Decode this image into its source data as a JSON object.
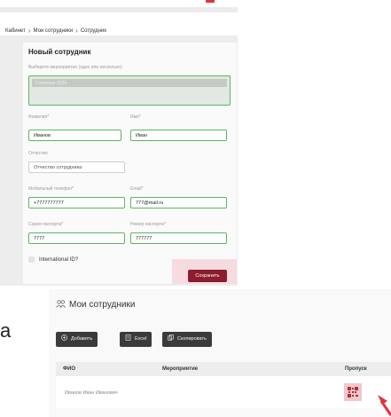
{
  "breadcrumb": {
    "items": [
      "Кабинет",
      "Мои сотрудники",
      "Сотрудник"
    ]
  },
  "form": {
    "title": "Новый сотрудник",
    "events_label": "Выберите мероприятие (одно или несколько)",
    "selected_event": "Comtesse 2024",
    "fields": {
      "lastname_label": "Фамилия*",
      "lastname_value": "Иванов",
      "firstname_label": "Имя*",
      "firstname_value": "Иван",
      "patronymic_label": "Отчество",
      "patronymic_placeholder": "Отчество сотрудника",
      "phone_label": "Мобильный телефон*",
      "phone_value": "+7777777777",
      "email_label": "Email*",
      "email_value": "777@mail.ru",
      "passport_series_label": "Серия паспорта*",
      "passport_series_value": "7777",
      "passport_number_label": "Номер паспорта*",
      "passport_number_value": "777777"
    },
    "international_label": "International ID?",
    "save_label": "Сохранить"
  },
  "side_letter": "а",
  "employees": {
    "title": "Мои сотрудники",
    "toolbar": {
      "add_label": "Добавить",
      "excel_label": "Excel",
      "copy_label": "Скопировать"
    },
    "columns": [
      "ФИО",
      "Мероприятие",
      "Пропуск"
    ],
    "rows": [
      {
        "name": "Иванов Иван Иванович",
        "event": ""
      }
    ]
  },
  "colors": {
    "accent_green": "#5ab760",
    "save_button": "#8c1d2c",
    "highlight_pink": "#f6dce0",
    "arrow_red": "#e0343f",
    "toolbar_dark": "#3b3b3b"
  },
  "icons": [
    "chevron-right-icon",
    "people-icon",
    "plus-circle-icon",
    "excel-file-icon",
    "copy-icon",
    "qr-code-icon",
    "red-arrow-icon"
  ]
}
